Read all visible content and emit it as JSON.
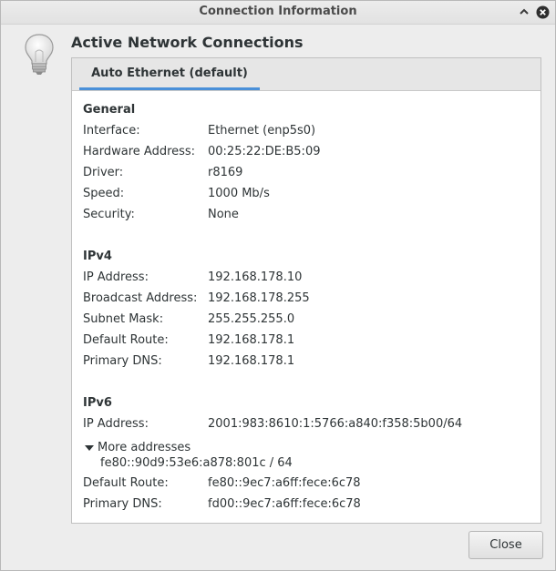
{
  "window": {
    "title": "Connection Information"
  },
  "heading": "Active Network Connections",
  "tab": {
    "label": "Auto Ethernet (default)"
  },
  "general": {
    "title": "General",
    "rows": [
      {
        "label": "Interface:",
        "value": "Ethernet (enp5s0)"
      },
      {
        "label": "Hardware Address:",
        "value": "00:25:22:DE:B5:09"
      },
      {
        "label": "Driver:",
        "value": "r8169"
      },
      {
        "label": "Speed:",
        "value": "1000 Mb/s"
      },
      {
        "label": "Security:",
        "value": "None"
      }
    ]
  },
  "ipv4": {
    "title": "IPv4",
    "rows": [
      {
        "label": "IP Address:",
        "value": "192.168.178.10"
      },
      {
        "label": "Broadcast Address:",
        "value": "192.168.178.255"
      },
      {
        "label": "Subnet Mask:",
        "value": "255.255.255.0"
      },
      {
        "label": "Default Route:",
        "value": "192.168.178.1"
      },
      {
        "label": "Primary DNS:",
        "value": "192.168.178.1"
      }
    ]
  },
  "ipv6": {
    "title": "IPv6",
    "ip_label": "IP Address:",
    "ip_value": "2001:983:8610:1:5766:a840:f358:5b00/64",
    "more_label": "More addresses",
    "more_value": "fe80::90d9:53e6:a878:801c / 64",
    "rows": [
      {
        "label": "Default Route:",
        "value": "fe80::9ec7:a6ff:fece:6c78"
      },
      {
        "label": "Primary DNS:",
        "value": "fd00::9ec7:a6ff:fece:6c78"
      }
    ]
  },
  "footer": {
    "close_label": "Close"
  },
  "icons": {
    "bulb": "lightbulb-icon",
    "minimize": "chevron-up-icon",
    "close": "close-icon"
  },
  "colors": {
    "accent": "#4a90d9"
  }
}
